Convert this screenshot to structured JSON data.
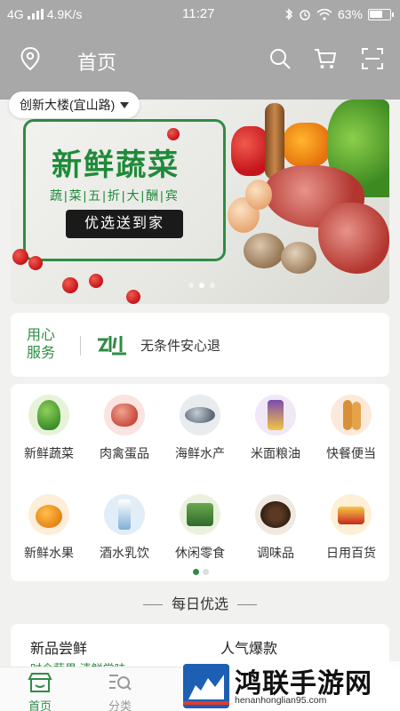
{
  "status_bar": {
    "network": "4G",
    "speed": "4.9K/s",
    "time": "11:27",
    "battery": "63%"
  },
  "nav": {
    "title": "首页",
    "location_icon": "location-pin-icon",
    "search_icon": "search-icon",
    "cart_icon": "cart-icon",
    "scan_icon": "scan-icon"
  },
  "location": {
    "label": "创新大楼(宜山路)"
  },
  "banner": {
    "headline": "新鲜蔬菜",
    "subline": "蔬|菜|五|折|大|酬|宾",
    "pill": "优选送到家",
    "slide_count": 3,
    "active_slide": 1
  },
  "service": {
    "label": "用心服务",
    "text": "无条件安心退"
  },
  "categories": [
    {
      "name": "新鲜蔬菜",
      "icon": "vegetable-icon"
    },
    {
      "name": "肉禽蛋品",
      "icon": "meat-icon"
    },
    {
      "name": "海鲜水产",
      "icon": "seafood-icon"
    },
    {
      "name": "米面粮油",
      "icon": "grain-oil-icon"
    },
    {
      "name": "快餐便当",
      "icon": "bread-icon"
    },
    {
      "name": "新鲜水果",
      "icon": "fruit-icon"
    },
    {
      "name": "酒水乳饮",
      "icon": "drink-icon"
    },
    {
      "name": "休闲零食",
      "icon": "snack-icon"
    },
    {
      "name": "调味品",
      "icon": "seasoning-icon"
    },
    {
      "name": "日用百货",
      "icon": "daily-goods-icon"
    }
  ],
  "category_pages": {
    "count": 2,
    "active": 0
  },
  "daily": {
    "title": "每日优选"
  },
  "featured": {
    "left_title": "新品尝鲜",
    "left_sub": "时令蔬果 清鲜尝味",
    "right_title": "人气爆款"
  },
  "tabs": [
    {
      "label": "首页",
      "icon": "home-store-icon",
      "active": true
    },
    {
      "label": "分类",
      "icon": "category-search-icon",
      "active": false
    }
  ],
  "watermark": {
    "title": "鸿联手游网",
    "url": "henanhonglian95.com"
  },
  "colors": {
    "accent": "#2f8c45",
    "top_bg": "#a8a8a8"
  }
}
